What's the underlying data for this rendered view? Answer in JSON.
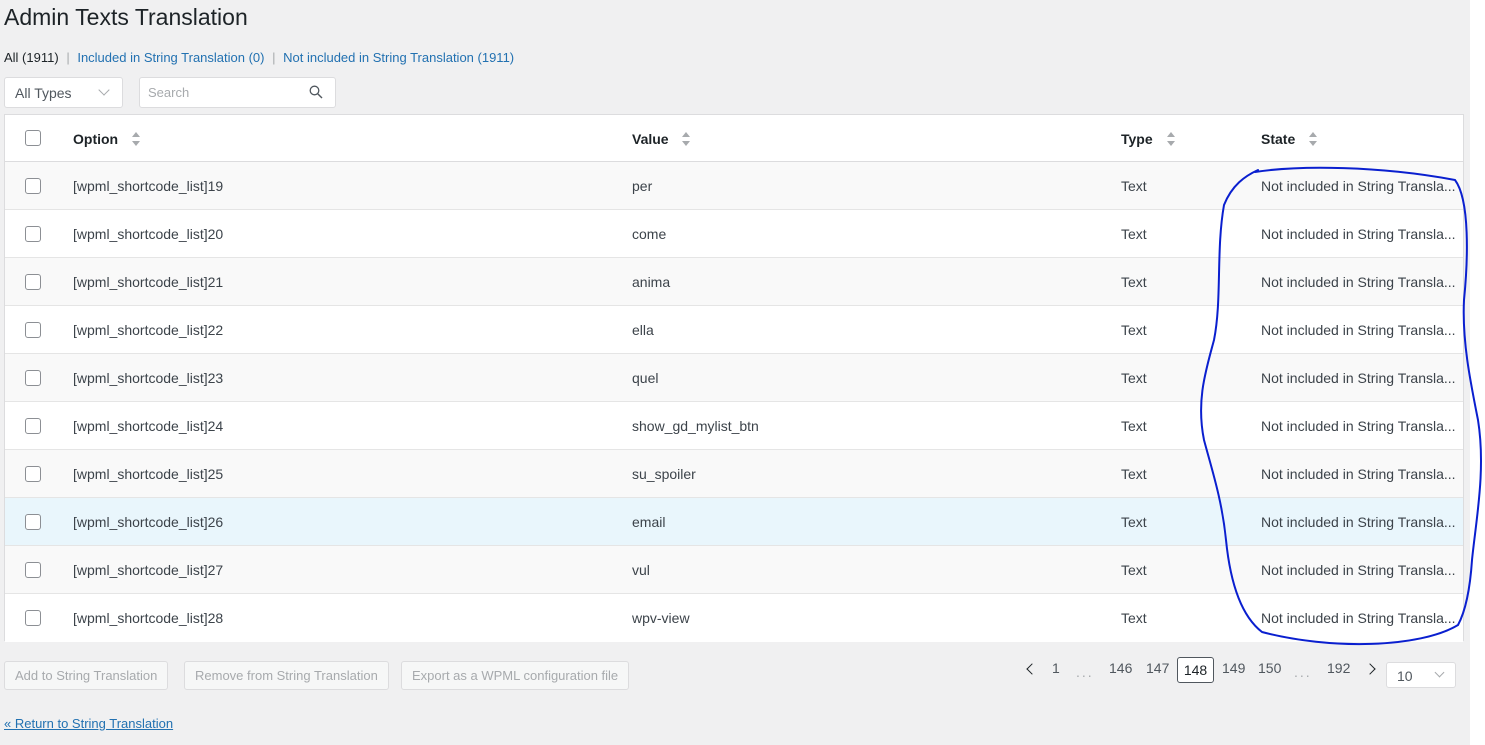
{
  "page": {
    "title": "Admin Texts Translation",
    "return_link": "« Return to String Translation"
  },
  "filters": {
    "all": "All (1911)",
    "included": "Included in String Translation (0)",
    "not_included": "Not included in String Translation (1911)",
    "separator": "|",
    "type_select": "All Types",
    "search_placeholder": "Search"
  },
  "table": {
    "columns": {
      "option": "Option",
      "value": "Value",
      "type": "Type",
      "state": "State"
    },
    "rows": [
      {
        "option": "[wpml_shortcode_list]19",
        "value": "per",
        "type": "Text",
        "state": "Not included in String Transla..."
      },
      {
        "option": "[wpml_shortcode_list]20",
        "value": "come",
        "type": "Text",
        "state": "Not included in String Transla..."
      },
      {
        "option": "[wpml_shortcode_list]21",
        "value": "anima",
        "type": "Text",
        "state": "Not included in String Transla..."
      },
      {
        "option": "[wpml_shortcode_list]22",
        "value": "ella",
        "type": "Text",
        "state": "Not included in String Transla..."
      },
      {
        "option": "[wpml_shortcode_list]23",
        "value": "quel",
        "type": "Text",
        "state": "Not included in String Transla..."
      },
      {
        "option": "[wpml_shortcode_list]24",
        "value": "show_gd_mylist_btn",
        "type": "Text",
        "state": "Not included in String Transla..."
      },
      {
        "option": "[wpml_shortcode_list]25",
        "value": "su_spoiler",
        "type": "Text",
        "state": "Not included in String Transla..."
      },
      {
        "option": "[wpml_shortcode_list]26",
        "value": "email",
        "type": "Text",
        "state": "Not included in String Transla..."
      },
      {
        "option": "[wpml_shortcode_list]27",
        "value": "vul",
        "type": "Text",
        "state": "Not included in String Transla..."
      },
      {
        "option": "[wpml_shortcode_list]28",
        "value": "wpv-view",
        "type": "Text",
        "state": "Not included in String Transla..."
      }
    ]
  },
  "actions": {
    "add": "Add to String Translation",
    "remove": "Remove from String Translation",
    "export": "Export as a WPML configuration file"
  },
  "pagination": {
    "pages": [
      "1",
      "146",
      "147",
      "148",
      "149",
      "150",
      "192"
    ],
    "current": "148",
    "ellipsis": "...",
    "per_page": "10"
  },
  "colors": {
    "link": "#2271b1",
    "annotation_stroke": "#0a1fcf",
    "hover_row": "#e9f6fc"
  }
}
